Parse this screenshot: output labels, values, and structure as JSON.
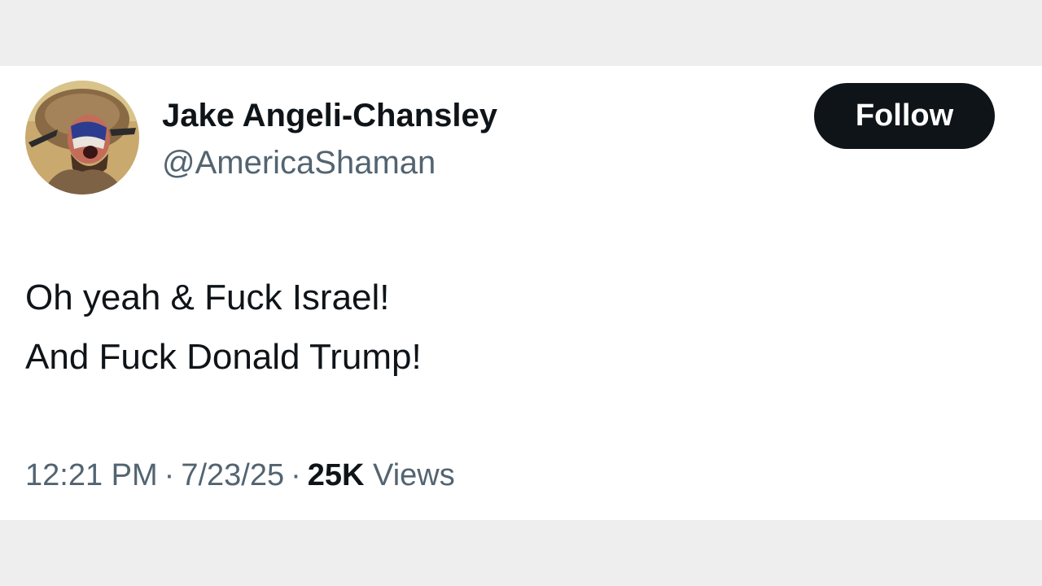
{
  "tweet": {
    "author": {
      "display_name": "Jake Angeli-Chansley",
      "handle": "@AmericaShaman",
      "avatar_icon": "profile-photo"
    },
    "follow_label": "Follow",
    "text_lines": [
      "Oh yeah & Fuck Israel!",
      "And Fuck Donald Trump!"
    ],
    "time": "12:21 PM",
    "separator": "·",
    "date": "7/23/25",
    "views_count": "25K",
    "views_label": "Views"
  },
  "colors": {
    "background": "#eeeeee",
    "card": "#ffffff",
    "text_primary": "#0f1419",
    "text_secondary": "#536471",
    "follow_button_bg": "#0f1419",
    "follow_button_text": "#ffffff"
  }
}
